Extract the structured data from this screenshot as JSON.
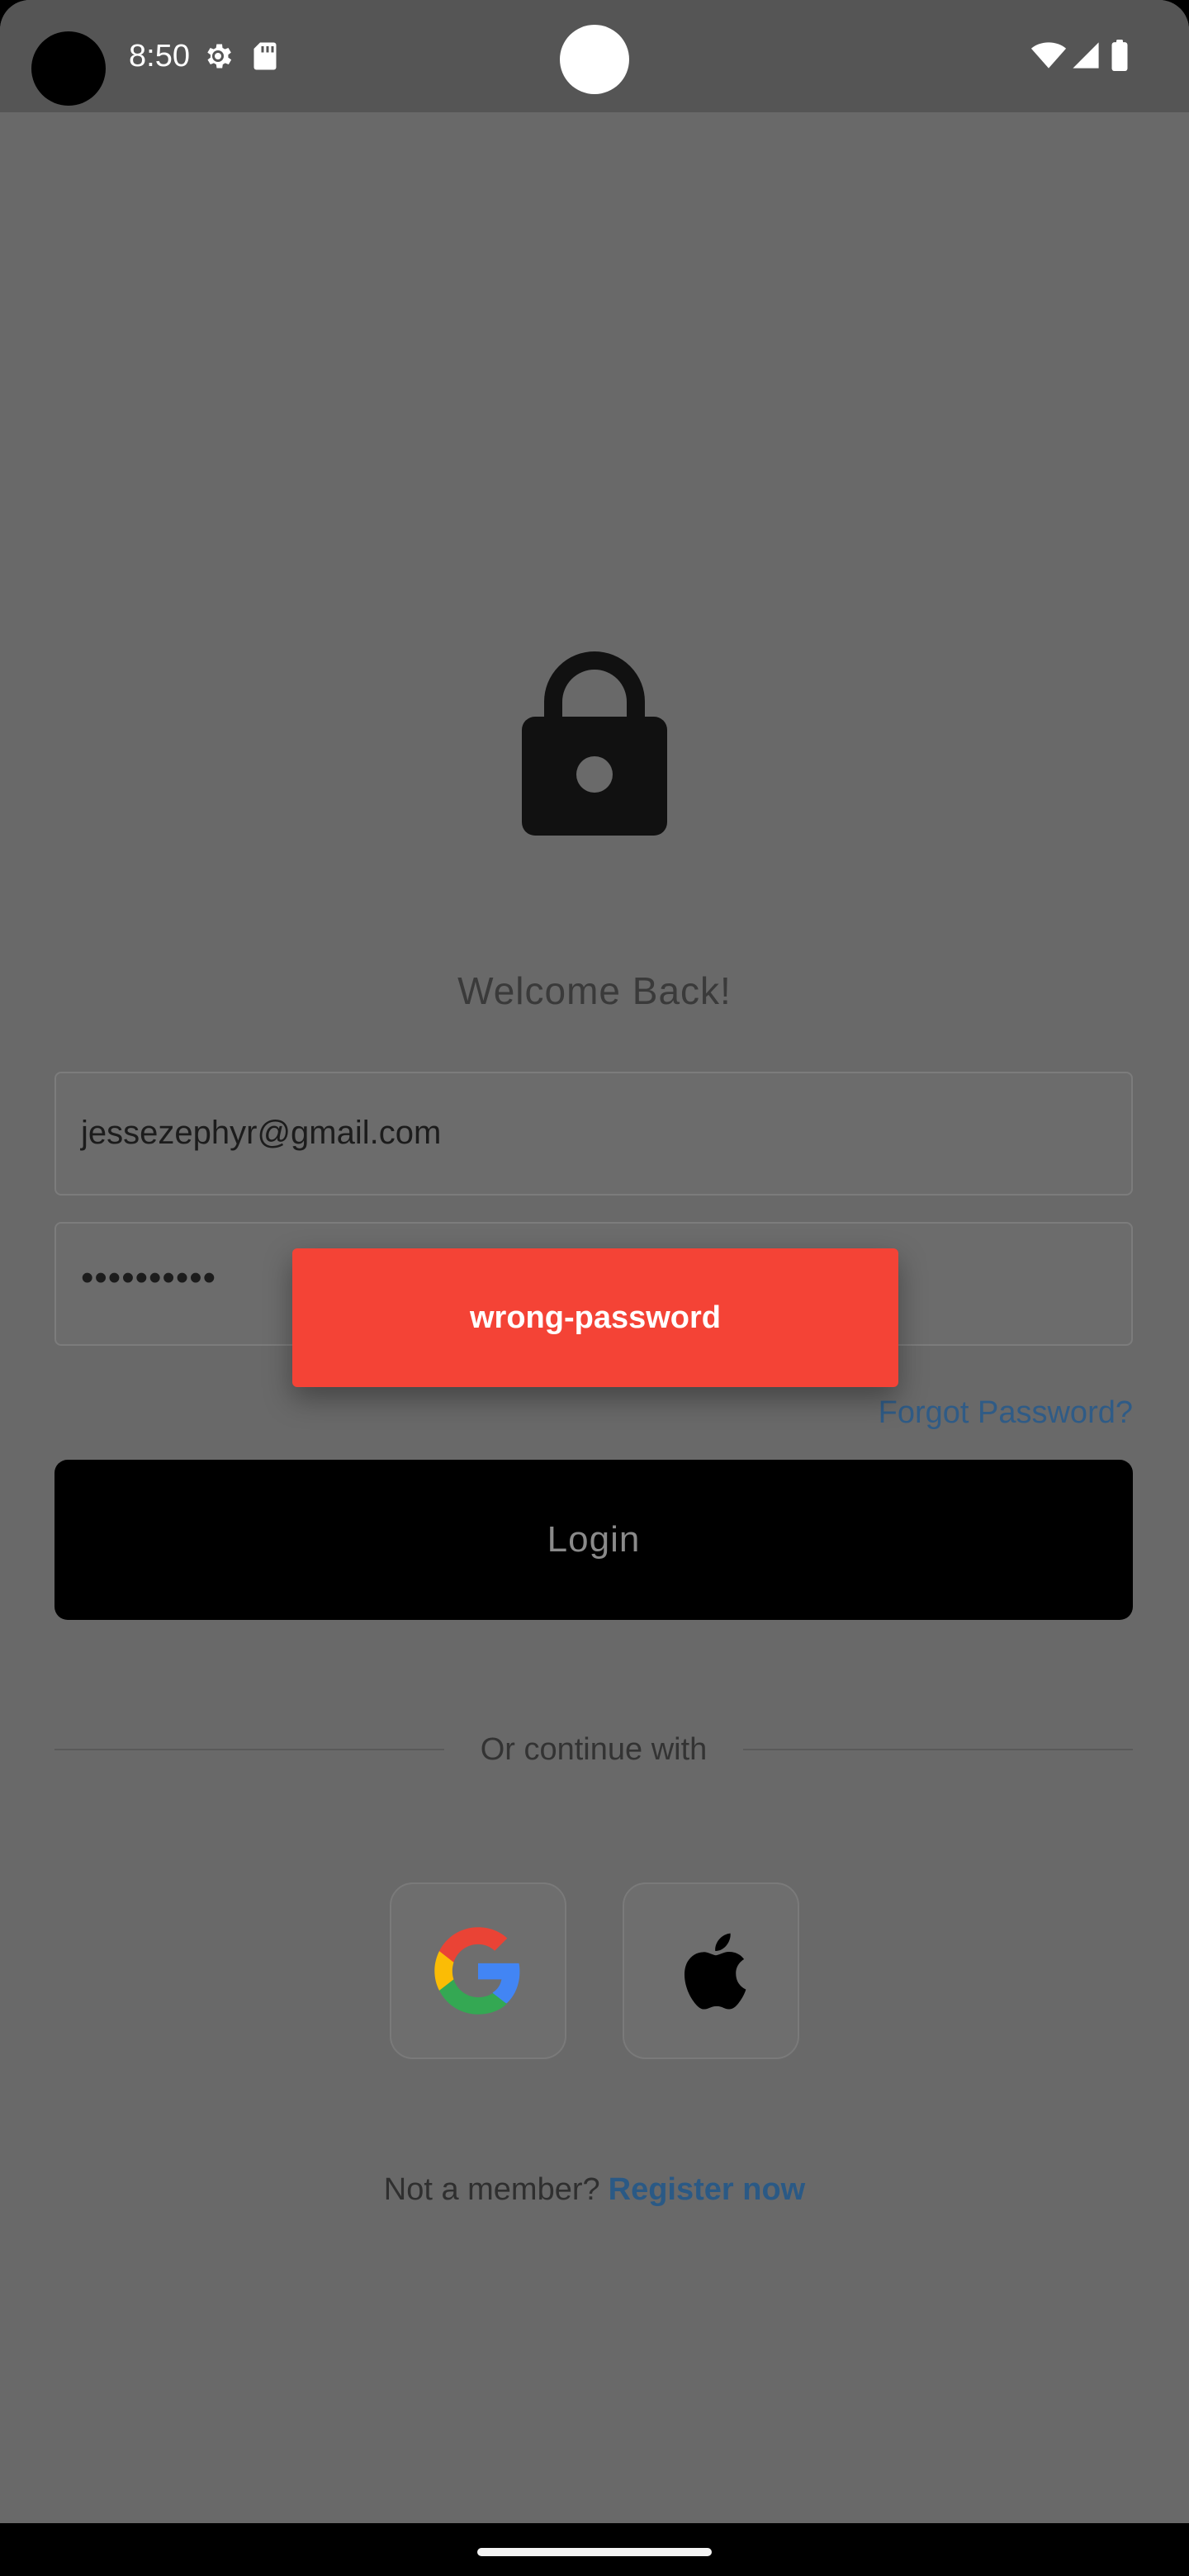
{
  "status_bar": {
    "time": "8:50",
    "icons": [
      "settings-icon",
      "sd-card-icon",
      "wifi-icon",
      "signal-icon",
      "battery-icon"
    ]
  },
  "login": {
    "lock_icon": "lock-icon",
    "welcome_text": "Welcome Back!",
    "email_value": "jessezephyr@gmail.com",
    "password_value": "••••••••••",
    "forgot_password": "Forgot Password?",
    "login_label": "Login",
    "or_continue": "Or continue with",
    "social": [
      "google-icon",
      "apple-icon"
    ],
    "not_member": "Not a member?",
    "register_now": "Register now"
  },
  "toast": {
    "message": "wrong-password",
    "color": "#f44336"
  },
  "colors": {
    "background": "#696969",
    "status_bar": "#555555",
    "link": "#2f5b86",
    "button": "#000000"
  }
}
